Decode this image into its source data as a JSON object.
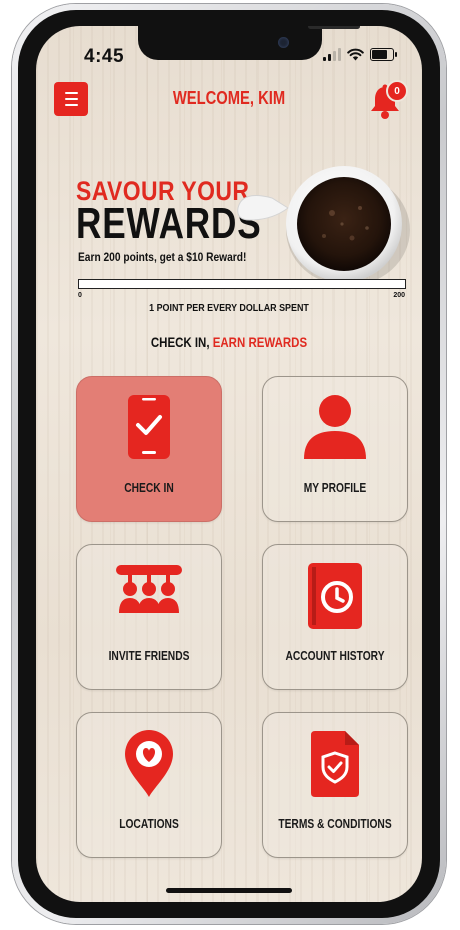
{
  "status_bar": {
    "time": "4:45"
  },
  "header": {
    "title": "WELCOME, KIM",
    "notification_count": "0"
  },
  "hero": {
    "line1": "SAVOUR YOUR",
    "line2": "REWARDS",
    "subtitle": "Earn 200 points, get a $10 Reward!"
  },
  "progress": {
    "min_label": "0",
    "max_label": "200",
    "current_points": 0,
    "note": "1 POINT PER EVERY DOLLAR SPENT"
  },
  "section": {
    "title_part1": "CHECK IN, ",
    "title_part2": "EARN REWARDS"
  },
  "tiles": [
    {
      "label": "CHECK IN",
      "icon": "phone-check-icon",
      "active": true
    },
    {
      "label": "MY PROFILE",
      "icon": "user-icon",
      "active": false
    },
    {
      "label": "INVITE FRIENDS",
      "icon": "group-icon",
      "active": false
    },
    {
      "label": "ACCOUNT HISTORY",
      "icon": "clock-book-icon",
      "active": false
    },
    {
      "label": "LOCATIONS",
      "icon": "location-heart-icon",
      "active": false
    },
    {
      "label": "TERMS & CONDITIONS",
      "icon": "shield-document-icon",
      "active": false
    }
  ],
  "colors": {
    "accent": "#e02a20",
    "active_tile": "#e37e75",
    "background": "#ece3d8"
  }
}
